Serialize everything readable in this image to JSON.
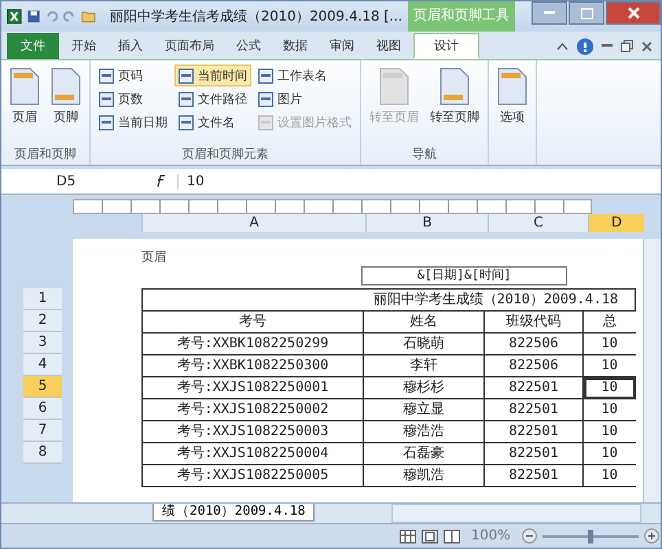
{
  "title_bar": {
    "title": "丽阳中学考生信考成绩（2010）2009.4.18  [...",
    "contextual_tab": "页眉和页脚工具"
  },
  "tabs": [
    {
      "label": "文件",
      "selected": false,
      "kind": "file"
    },
    {
      "label": "开始",
      "selected": false,
      "kind": "tab"
    },
    {
      "label": "插入",
      "selected": false,
      "kind": "tab"
    },
    {
      "label": "页面布局",
      "selected": false,
      "kind": "tab"
    },
    {
      "label": "公式",
      "selected": false,
      "kind": "tab"
    },
    {
      "label": "数据",
      "selected": false,
      "kind": "tab"
    },
    {
      "label": "审阅",
      "selected": false,
      "kind": "tab"
    },
    {
      "label": "视图",
      "selected": false,
      "kind": "tab"
    },
    {
      "label": "设计",
      "selected": true,
      "kind": "tab"
    }
  ],
  "ribbon": [
    {
      "name": "页眉和页脚",
      "kind": "large",
      "items": [
        {
          "label": "页眉",
          "disabled": false,
          "selected": false
        },
        {
          "label": "页脚",
          "disabled": false,
          "selected": false
        }
      ]
    },
    {
      "name": "页眉和页脚元素",
      "kind": "small",
      "items": [
        {
          "label": "页码",
          "disabled": false,
          "selected": false
        },
        {
          "label": "页数",
          "disabled": false,
          "selected": false
        },
        {
          "label": "当前日期",
          "disabled": false,
          "selected": false
        },
        {
          "label": "当前时间",
          "disabled": false,
          "selected": true
        },
        {
          "label": "文件路径",
          "disabled": false,
          "selected": false
        },
        {
          "label": "文件名",
          "disabled": false,
          "selected": false
        },
        {
          "label": "工作表名",
          "disabled": false,
          "selected": false
        },
        {
          "label": "图片",
          "disabled": false,
          "selected": false
        },
        {
          "label": "设置图片格式",
          "disabled": true,
          "selected": false
        }
      ]
    },
    {
      "name": "导航",
      "kind": "large",
      "items": [
        {
          "label": "转至页眉",
          "disabled": true,
          "selected": false
        },
        {
          "label": "转至页脚",
          "disabled": false,
          "selected": false
        }
      ]
    },
    {
      "kind": "large",
      "items": [
        {
          "label": "选项",
          "disabled": false,
          "selected": false
        }
      ]
    }
  ],
  "formula_bar": {
    "cell": "D5",
    "formula": "10"
  },
  "columns": [
    {
      "label": "A",
      "selected": false
    },
    {
      "label": "B",
      "selected": false
    },
    {
      "label": "C",
      "selected": false
    },
    {
      "label": "D",
      "selected": true
    }
  ],
  "row_numbers": [
    {
      "label": "1",
      "selected": false
    },
    {
      "label": "2",
      "selected": false
    },
    {
      "label": "3",
      "selected": false
    },
    {
      "label": "4",
      "selected": false
    },
    {
      "label": "5",
      "selected": true
    },
    {
      "label": "6",
      "selected": false
    },
    {
      "label": "7",
      "selected": false
    },
    {
      "label": "8",
      "selected": false
    }
  ],
  "page": {
    "header_label": "页眉",
    "header_field": "&[日期]&[时间]"
  },
  "table": {
    "title": "丽阳中学考生成绩（2010）2009.4.18",
    "headers": [
      "考号",
      "姓名",
      "班级代码",
      "总"
    ],
    "rows": [
      [
        "考号:XXBK1082250299",
        "石晓萌",
        "822506",
        "10"
      ],
      [
        "考号:XXBK1082250300",
        "李轩",
        "822506",
        "10"
      ],
      [
        "考号:XXJS1082250001",
        "穆杉杉",
        "822501",
        "10"
      ],
      [
        "考号:XXJS1082250002",
        "穆立显",
        "822501",
        "10"
      ],
      [
        "考号:XXJS1082250003",
        "穆浩浩",
        "822501",
        "10"
      ],
      [
        "考号:XXJS1082250004",
        "石磊豪",
        "822501",
        "10"
      ],
      [
        "考号:XXJS1082250005",
        "穆凯浩",
        "822501",
        "10"
      ]
    ]
  },
  "sheet_tab": "绩（2010）2009.4.18",
  "status_bar": {
    "zoom": "100%",
    "zoom_slider": {
      "level": 0.5
    }
  }
}
